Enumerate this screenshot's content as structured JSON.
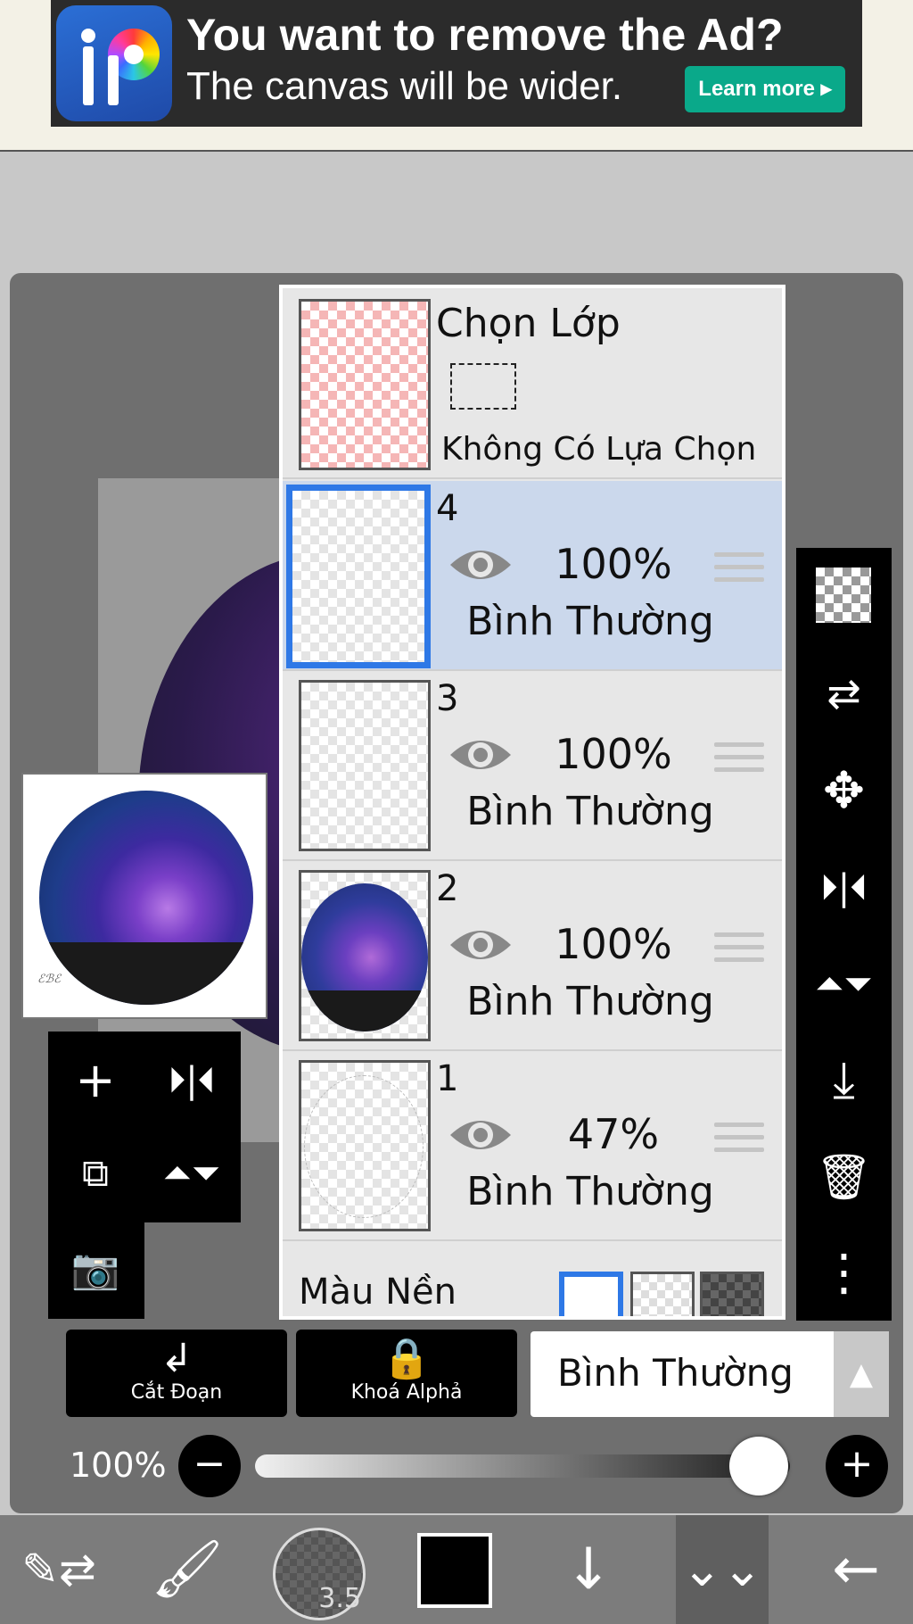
{
  "ad": {
    "title": "You want to remove the Ad?",
    "subtitle": "The canvas will be wider.",
    "button": "Learn more ▸",
    "logo_icon": "ibispaint-logo-icon"
  },
  "layer_panel": {
    "selection_layer": {
      "title": "Chọn Lớp",
      "status": "Không Có Lựa Chọn"
    },
    "layers": [
      {
        "number": "4",
        "opacity": "100%",
        "blend_mode": "Bình Thường",
        "selected": true
      },
      {
        "number": "3",
        "opacity": "100%",
        "blend_mode": "Bình Thường",
        "selected": false
      },
      {
        "number": "2",
        "opacity": "100%",
        "blend_mode": "Bình Thường",
        "selected": false
      },
      {
        "number": "1",
        "opacity": "47%",
        "blend_mode": "Bình Thường",
        "selected": false
      }
    ],
    "background": {
      "label": "Màu Nền"
    }
  },
  "blend_controls": {
    "clipping_label": "Cắt Đoạn",
    "alpha_lock_label": "Khoá Alphả",
    "blend_mode_value": "Bình Thường",
    "opacity_label": "100%",
    "opacity_value": 1.0
  },
  "bottom_nav": {
    "brush_size": "3.5",
    "color": "#000000"
  },
  "colors": {
    "selected_row": "#cbd8ec",
    "accent_blue": "#2e78e6",
    "ad_button": "#0aa98a"
  }
}
